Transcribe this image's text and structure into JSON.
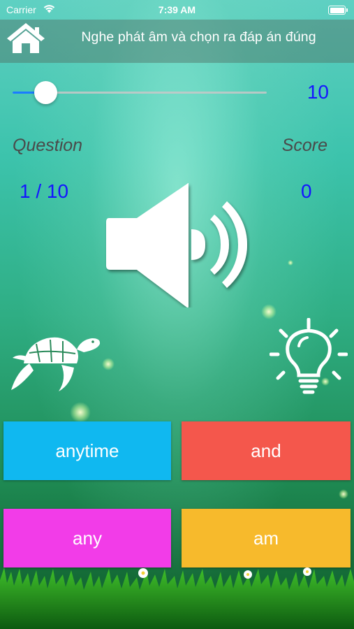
{
  "status_bar": {
    "carrier": "Carrier",
    "time": "7:39 AM"
  },
  "header": {
    "title": "Nghe phát âm và chọn ra đáp án đúng",
    "home_icon": "home-icon"
  },
  "slider": {
    "value": 10,
    "fraction": 0.13
  },
  "stats": {
    "question_label": "Question",
    "question_value": "1 / 10",
    "score_label": "Score",
    "score_value": "0"
  },
  "controls": {
    "speaker_icon": "speaker-icon",
    "slow_icon": "turtle-icon",
    "hint_icon": "lightbulb-icon"
  },
  "answers": [
    {
      "label": "anytime",
      "color": "#10b8f0"
    },
    {
      "label": "and",
      "color": "#f4574c"
    },
    {
      "label": "any",
      "color": "#f23ce8"
    },
    {
      "label": "am",
      "color": "#f7ba2c"
    }
  ],
  "colors": {
    "accent_blue": "#1414ff",
    "slider_fill": "#1a7cff",
    "label_gray": "#4a4a4a"
  }
}
